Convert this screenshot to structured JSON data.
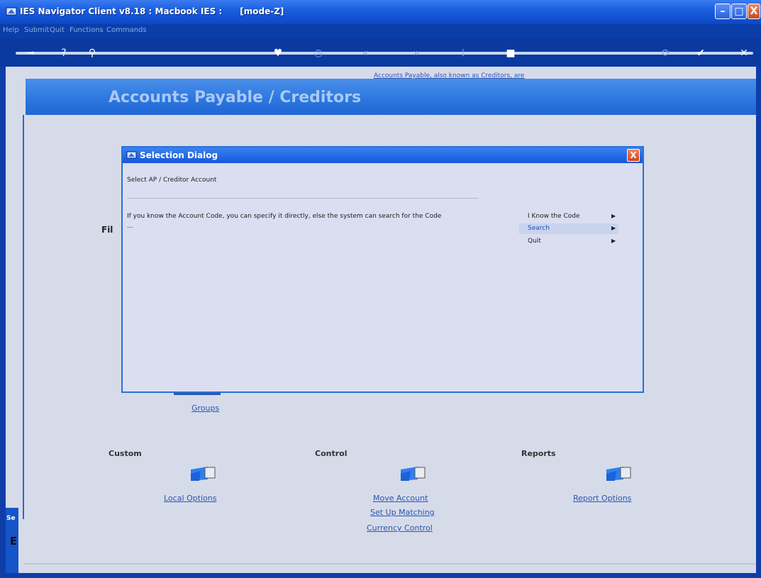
{
  "window": {
    "title": "IES Navigator Client v8.18 : Macbook IES :      [mode-Z]",
    "controls": {
      "minimize": "–",
      "maximize": "□",
      "close": "X"
    }
  },
  "menubar": [
    "Help",
    "Submit",
    "Quit",
    "Functions",
    "Commands"
  ],
  "toolbar": {
    "icons": [
      "key-icon",
      "help-icon",
      "search-icon",
      "heart-icon",
      "clock-icon",
      "rewind-icon",
      "fast-forward-icon",
      "grid-icon",
      "stop-icon",
      "refresh-icon",
      "ok-icon",
      "cancel-icon"
    ],
    "glyphs": [
      "⊸",
      "?",
      "⚲",
      "♥",
      "◷",
      "«",
      "»",
      "⁞",
      "■",
      "⟳",
      "✔",
      "✕"
    ]
  },
  "page": {
    "title": "Accounts Payable / Creditors",
    "intro": "Accounts Payable, also known as Creditors, are",
    "files_label": "Fil",
    "groups_link": "Groups",
    "sections": {
      "custom": {
        "label": "Custom",
        "links": [
          "Local Options"
        ]
      },
      "control": {
        "label": "Control",
        "links": [
          "Move Account",
          "Set Up Matching",
          "Currency Control"
        ]
      },
      "reports": {
        "label": "Reports",
        "links": [
          "Report Options"
        ]
      }
    },
    "side_tab": {
      "label": "Se",
      "char": "E"
    }
  },
  "dialog": {
    "title": "Selection Dialog",
    "close_label": "X",
    "heading": "Select AP / Creditor Account",
    "description": "If you know the Account Code, you can specify it directly, else the system can search for the Code",
    "ellipsis": "...",
    "options": [
      {
        "label": "I Know the Code",
        "selected": false
      },
      {
        "label": "Search",
        "selected": true
      },
      {
        "label": "Quit",
        "selected": false
      }
    ],
    "arrow": "▶"
  },
  "colors": {
    "titlebar": "#1b5fe0",
    "client": "#d6dbe9",
    "banner": "#2d78e0",
    "link": "#2a55b3"
  }
}
